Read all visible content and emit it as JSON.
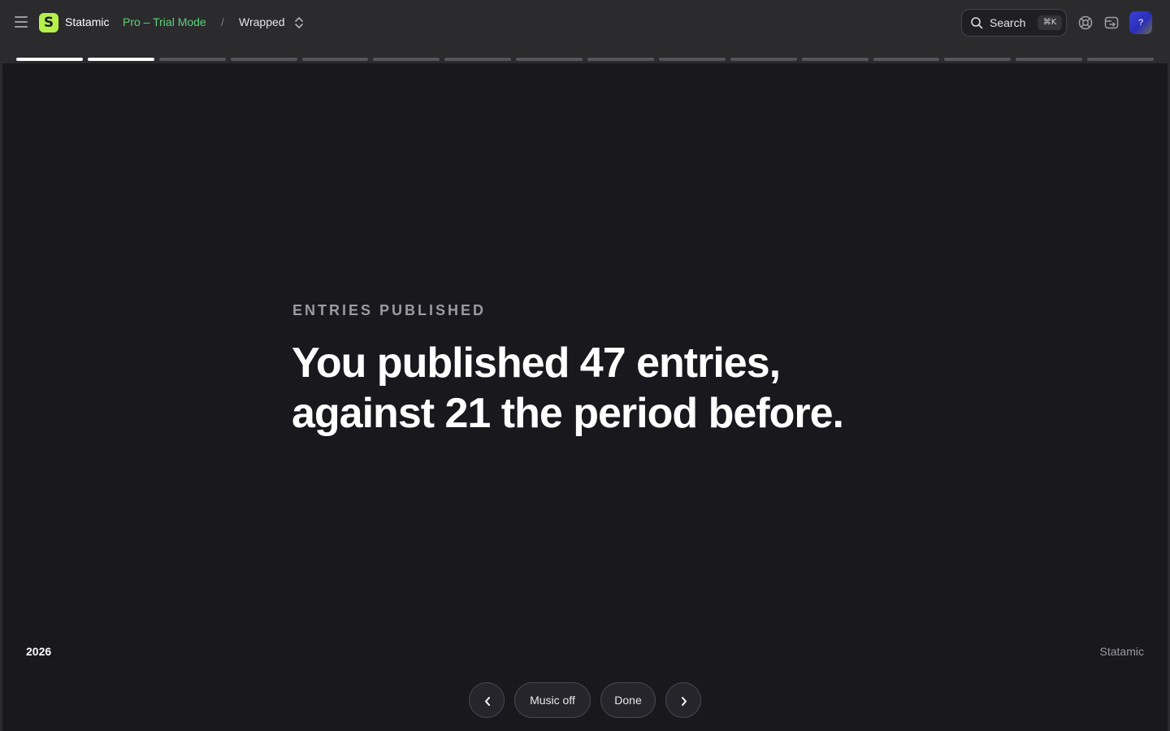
{
  "header": {
    "brand": "Statamic",
    "license": "Pro – Trial Mode",
    "breadcrumb_separator": "/",
    "breadcrumb": "Wrapped",
    "search_label": "Search",
    "search_shortcut": "⌘K",
    "avatar_initial": "?",
    "logo_letter": "S",
    "icons": [
      "hamburger-icon",
      "chevrons-up-down-icon",
      "search-icon",
      "lifebuoy-icon",
      "site-switch-icon"
    ]
  },
  "progress": {
    "total_segments": 16,
    "active_segments": 2
  },
  "slide": {
    "eyebrow": "ENTRIES PUBLISHED",
    "headline_line1": "You published 47 entries,",
    "headline_line2": "against 21 the period before.",
    "year": "2026",
    "footer_brand": "Statamic"
  },
  "controls": {
    "music_label": "Music off",
    "done_label": "Done"
  },
  "colors": {
    "accent": "#b6f04a",
    "trial": "#5fd27a",
    "slide_bg": "#18181d",
    "topbar_bg": "#2b2b2e"
  }
}
